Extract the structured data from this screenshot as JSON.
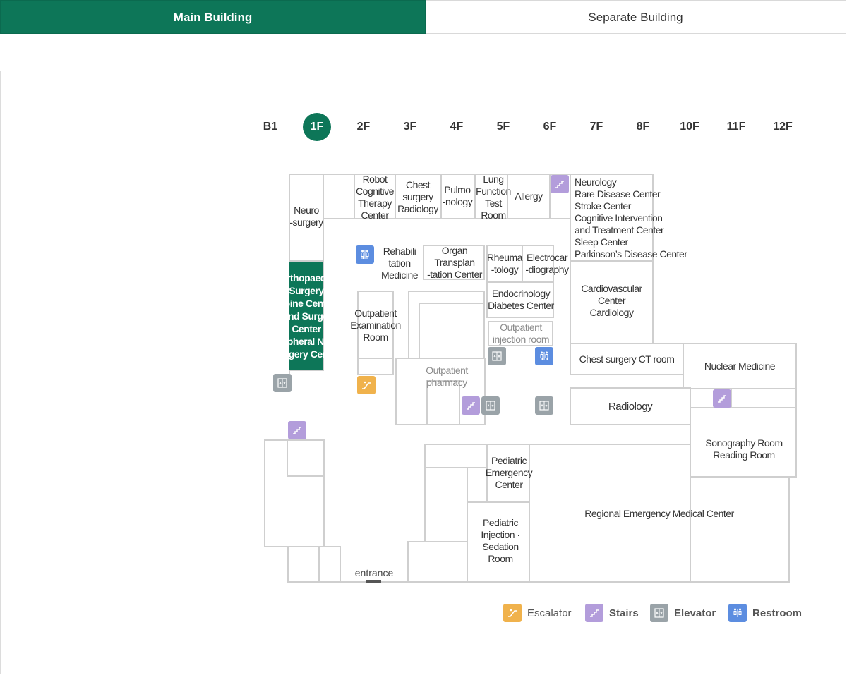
{
  "tabs": {
    "main_building": "Main Building",
    "separate_building": "Separate Building"
  },
  "floors": [
    "B1",
    "1F",
    "2F",
    "3F",
    "4F",
    "5F",
    "6F",
    "7F",
    "8F",
    "10F",
    "11F",
    "12F"
  ],
  "active_floor": "1F",
  "rooms": {
    "neurosurgery": [
      "Neuro",
      "-surgery"
    ],
    "robot_therapy": [
      "Robot",
      "Cognitive",
      "Therapy",
      "Center"
    ],
    "chest_radiology": [
      "Chest",
      "surgery",
      "Radiology"
    ],
    "pulmonology": [
      "Pulmo",
      "-nology"
    ],
    "lung_function": [
      "Lung",
      "Function",
      "Test",
      "Room"
    ],
    "allergy": [
      "Allergy"
    ],
    "neurology_group": [
      "Neurology",
      "Rare Disease Center",
      "Stroke Center",
      "Cognitive Intervention",
      "and Treatment Center",
      "Sleep Center",
      "Parkinson’s Disease Center"
    ],
    "orthopaedic": [
      "Orthopaedic",
      "Surgery",
      "Spine Center",
      "Hand Surgery",
      "Center",
      "Peripheral Nerve",
      "Surgery Center"
    ],
    "rehabilitation": [
      "Rehabili",
      "tation",
      "Medicine"
    ],
    "organ_transplant": [
      "Organ",
      "Transplan",
      "-tation Center"
    ],
    "rheumatology": [
      "Rheuma",
      "-tology"
    ],
    "electrocardiography": [
      "Electrocar",
      "-diography"
    ],
    "endocrinology": [
      "Endocrinology",
      "Diabetes Center"
    ],
    "cardiovascular": [
      "Cardiovascular",
      "Center",
      "Cardiology"
    ],
    "outpatient_exam": [
      "Outpatient",
      "Examination",
      "Room"
    ],
    "outpatient_injection": [
      "Outpatient",
      "injection room"
    ],
    "outpatient_pharmacy": [
      "Outpatient",
      "pharmacy"
    ],
    "chest_ct": [
      "Chest surgery CT room"
    ],
    "nuclear_medicine": [
      "Nuclear Medicine"
    ],
    "radiology": [
      "Radiology"
    ],
    "sonography": [
      "Sonography Room",
      "Reading Room"
    ],
    "pediatric_emergency": [
      "Pediatric",
      "Emergency",
      "Center"
    ],
    "pediatric_injection": [
      "Pediatric",
      "Injection ·",
      "Sedation",
      "Room"
    ],
    "regional_emergency": [
      "Regional Emergency Medical Center"
    ]
  },
  "entrance_label": "entrance",
  "legend": {
    "escalator": "Escalator",
    "stairs": "Stairs",
    "elevator": "Elevator",
    "restroom": "Restroom"
  },
  "colors": {
    "brand_green": "#0d7658",
    "stairs": "#b39ddb",
    "elevator": "#9aa3a8",
    "restroom": "#5c8de0",
    "escalator": "#f0b24c"
  },
  "icons": {
    "stairs": "stairs-icon",
    "elevator": "elevator-icon",
    "restroom": "restroom-icon",
    "escalator": "escalator-icon"
  }
}
